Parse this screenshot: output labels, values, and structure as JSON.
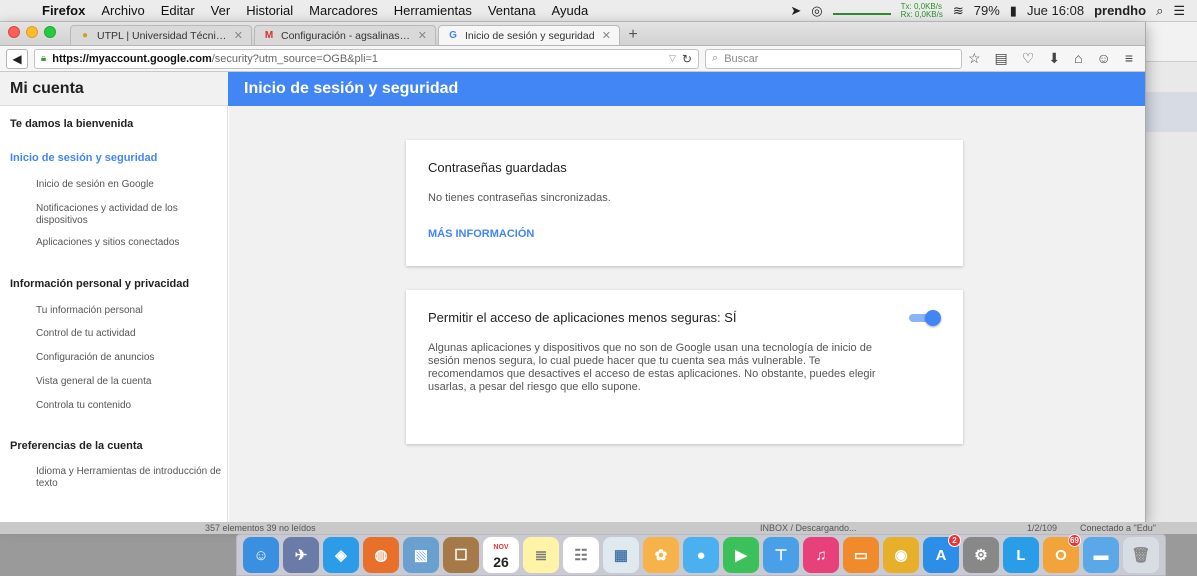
{
  "menubar": {
    "app": "Firefox",
    "items": [
      "Archivo",
      "Editar",
      "Ver",
      "Historial",
      "Marcadores",
      "Herramientas",
      "Ventana",
      "Ayuda"
    ],
    "net_tx": "Tx:  0,0KB/s",
    "net_rx": "Rx:  0,0KB/s",
    "battery": "79%",
    "clock": "Jue 16:08",
    "user": "prendho"
  },
  "browser": {
    "tabs": [
      {
        "label": "UTPL | Universidad Técnica...",
        "favicon": "utpl-icon"
      },
      {
        "label": "Configuración - agsalinas@...",
        "favicon": "gmail-icon"
      },
      {
        "label": "Inicio de sesión y seguridad",
        "favicon": "google-icon"
      }
    ],
    "url_host": "https://myaccount.google.com",
    "url_path": "/security?utm_source=OGB&pli=1",
    "search_placeholder": "Buscar"
  },
  "page": {
    "header_left": "Mi cuenta",
    "header_title": "Inicio de sesión y seguridad",
    "sidebar": {
      "welcome": "Te damos la bienvenida",
      "sec1": {
        "title": "Inicio de sesión y seguridad",
        "items": [
          "Inicio de sesión en Google",
          "Notificaciones y actividad de los dispositivos",
          "Aplicaciones y sitios conectados"
        ]
      },
      "sec2": {
        "title": "Información personal y privacidad",
        "items": [
          "Tu información personal",
          "Control de tu actividad",
          "Configuración de anuncios",
          "Vista general de la cuenta",
          "Controla tu contenido"
        ]
      },
      "sec3": {
        "title": "Preferencias de la cuenta",
        "items": [
          "Idioma y Herramientas de introducción de texto"
        ]
      }
    },
    "card1": {
      "title": "Contraseñas guardadas",
      "text": "No tienes contraseñas sincronizadas.",
      "link": "MÁS INFORMACIÓN"
    },
    "card2": {
      "title": "Permitir el acceso de aplicaciones menos seguras: SÍ",
      "text": "Algunas aplicaciones y dispositivos que no son de Google usan una tecnología de inicio de sesión menos segura, lo cual puede hacer que tu cuenta sea más vulnerable. Te recomendamos que desactives el acceso de estas aplicaciones. No obstante, puedes elegir usarlas, a pesar del riesgo que ello supone.",
      "toggle_on": true
    }
  },
  "background": {
    "status_left": "357 elementos    39 no leídos",
    "status_mid": "INBOX / Descargando...",
    "status_count": "1/2/109",
    "status_right": "Conectado a \"Edu\""
  },
  "dock": {
    "calendar_month": "NOV",
    "calendar_day": "26",
    "appstore_badge": "2",
    "app_badge": "69"
  },
  "colors": {
    "accent": "#4285f4",
    "sidebar_bg": "#f1f1f1"
  }
}
